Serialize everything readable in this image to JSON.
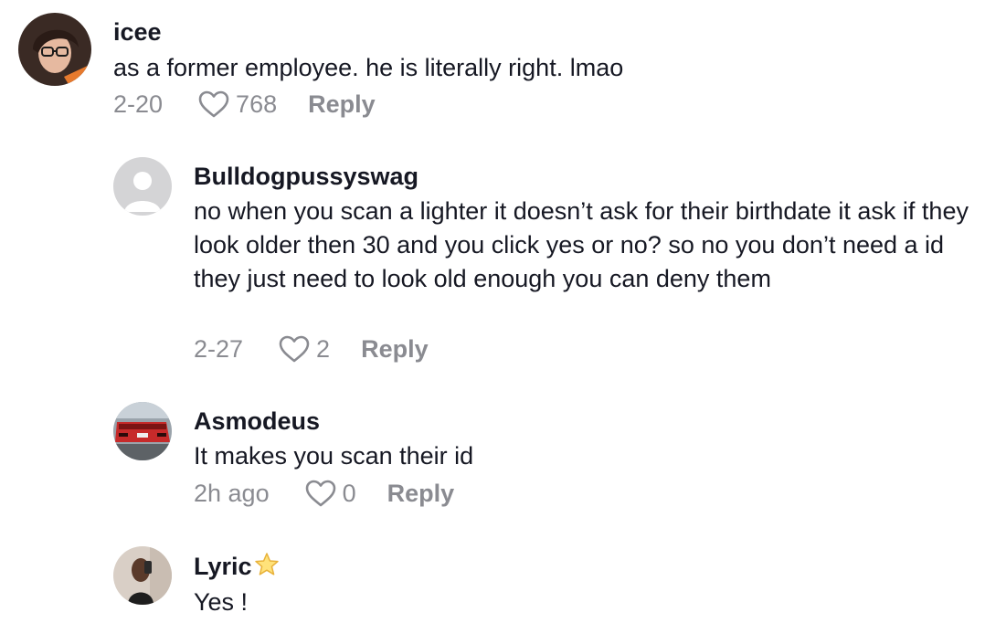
{
  "comments": [
    {
      "username": "icee",
      "text": "as a former employee. he is literally right. lmao",
      "date": "2-20",
      "likes": "768",
      "reply_label": "Reply",
      "avatar": "profile-photo"
    },
    {
      "username": "Bulldogpussyswag",
      "text": "no when you scan a lighter it doesn’t ask for their birthdate it ask if they look older then 30 and you click yes or no? so no you don’t need a id they just need to look old enough you can deny them",
      "date": "2-27",
      "likes": "2",
      "reply_label": "Reply",
      "avatar": "default-user-icon"
    },
    {
      "username": "Asmodeus",
      "text": "It makes you scan their id",
      "date": "2h ago",
      "likes": "0",
      "reply_label": "Reply",
      "avatar": "red-car-photo"
    },
    {
      "username": "Lyric",
      "badge": "star-emoji",
      "text": "Yes !",
      "avatar": "selfie-photo"
    }
  ],
  "colors": {
    "primary_text": "#161823",
    "secondary_text": "#8a8b91",
    "background": "#ffffff"
  }
}
